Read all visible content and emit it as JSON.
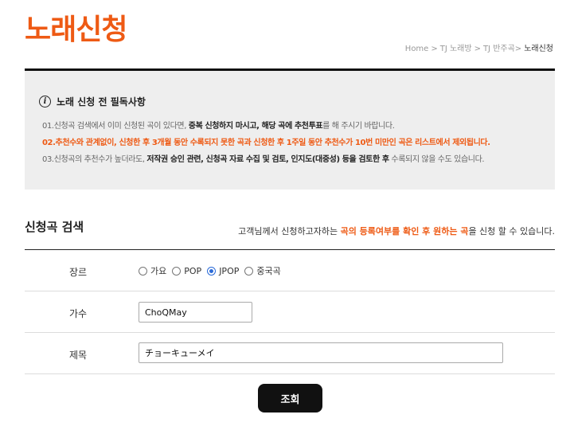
{
  "header": {
    "title": "노래신청",
    "breadcrumb": [
      "Home",
      "TJ 노래방",
      "TJ 반주곡",
      "노래신청"
    ],
    "breadcrumb_sep": ">"
  },
  "notice": {
    "title": "노래 신청 전 필독사항",
    "line1": {
      "a": "01.신청곡 검색에서 이미 신청된 곡이 있다면, ",
      "b": "중복 신청하지 마시고, 해당 곡에 추천투표",
      "c": "를 해 주시기 바랍니다."
    },
    "line2": "02.추천수와 관계없이, 신청한 후 3개월 동안 수록되지 못한 곡과 신청한 후 1주일 동안 추천수가 10번 미만인 곡은 리스트에서 제외됩니다.",
    "line3": {
      "a": "03.신청곡의 추천수가 높더라도, ",
      "b": "저작권 승인 관련, 신청곡 자료 수집 및 검토, 인지도(대중성) 등을 검토한 후",
      "c": " 수록되지 않을 수도 있습니다."
    }
  },
  "search": {
    "title": "신청곡 검색",
    "desc": {
      "a": "고객님께서 신청하고자하는 ",
      "b": "곡의 등록여부를 확인 후 원하는 곡",
      "c": "을 신청 할 수 있습니다."
    }
  },
  "form": {
    "genre_label": "장르",
    "genres": [
      "가요",
      "POP",
      "JPOP",
      "중국곡"
    ],
    "selected_genre": "JPOP",
    "singer_label": "가수",
    "singer_value": "ChoQMay",
    "title_label": "제목",
    "title_value": "チョーキューメイ",
    "submit_label": "조회"
  },
  "colors": {
    "accent": "#ee5a14",
    "radio_selected": "#2b6bd8"
  }
}
